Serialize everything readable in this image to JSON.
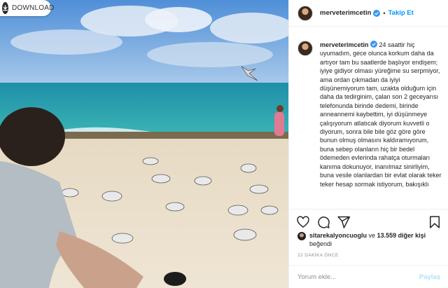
{
  "photo": {
    "download_label": "DOWNLOAD",
    "description_icon": "beach-seagulls-photo"
  },
  "header": {
    "username": "merveterimcetin",
    "separator": "•",
    "follow_label": "Takip Et"
  },
  "caption": {
    "username": "merveterimcetin",
    "text": "24 saattir hiç uyumadım, gece olunca korkum daha da artıyor tam bu saatlerde başlıyor endişem; iyiye gidiyor olması yüreğime su serpmiyor, ama ordan çıkmadan da iyiyi düşünemiyorum tam, uzakta olduğum için daha da tedirginim, çalan son 2 geceyarısı telefonunda birinde dedemi, birinde anneannemi kaybettim, iyi düşünmeye çalışıyorum atlatıcak diyorum kuvvetli o diyorum, sonra bile bile göz göre göre bunun olmuş olmasını kaldıramıyorum, buna sebep olanların hiç bir bedel ödemeden evlerinda rahatça oturmaları kanıma dokunuyor, inanılmaz sinirliyim, buna vesile olanlardan bir evlat olarak teker teker hesap sormak istiyorum, bakışıklı"
  },
  "likes": {
    "first_user": "sitarekalyoncuoglu",
    "connector": "ve",
    "others": "13.559 diğer kişi",
    "suffix": "beğendi"
  },
  "timestamp": "22 DAKİKA ÖNCE",
  "comment": {
    "placeholder": "Yorum ekle...",
    "post_label": "Paylaş"
  },
  "colors": {
    "accent": "#0095f6",
    "verified": "#3897f0",
    "text": "#262626",
    "muted": "#8e8e8e",
    "post_disabled": "#b2dffc"
  }
}
